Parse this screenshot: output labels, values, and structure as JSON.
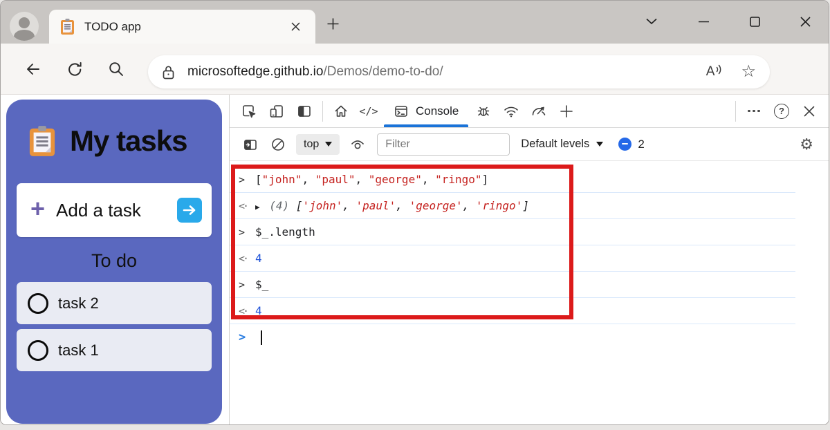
{
  "browser": {
    "tab_title": "TODO app",
    "url_host": "microsoftedge.github.io",
    "url_path": "/Demos/demo-to-do/"
  },
  "todo_app": {
    "title": "My tasks",
    "add_task_label": "Add a task",
    "section_heading": "To do",
    "tasks": [
      {
        "label": "task 2"
      },
      {
        "label": "task 1"
      }
    ]
  },
  "devtools": {
    "console_tab_label": "Console",
    "context_selector": "top",
    "filter_placeholder": "Filter",
    "levels_label": "Default levels",
    "issues_count": "2",
    "prompt_symbol": ">",
    "console_entries": [
      {
        "kind": "input",
        "segments": [
          {
            "t": "[",
            "c": "p"
          },
          {
            "t": "\"john\"",
            "c": "s"
          },
          {
            "t": ", ",
            "c": "p"
          },
          {
            "t": "\"paul\"",
            "c": "s"
          },
          {
            "t": ", ",
            "c": "p"
          },
          {
            "t": "\"george\"",
            "c": "s"
          },
          {
            "t": ", ",
            "c": "p"
          },
          {
            "t": "\"ringo\"",
            "c": "s"
          },
          {
            "t": "]",
            "c": "p"
          }
        ]
      },
      {
        "kind": "output",
        "italic": true,
        "segments": [
          {
            "t": "▶",
            "c": "tri"
          },
          {
            "t": " (4) ",
            "c": "g"
          },
          {
            "t": "[",
            "c": "p"
          },
          {
            "t": "'john'",
            "c": "s"
          },
          {
            "t": ", ",
            "c": "p"
          },
          {
            "t": "'paul'",
            "c": "s"
          },
          {
            "t": ", ",
            "c": "p"
          },
          {
            "t": "'george'",
            "c": "s"
          },
          {
            "t": ", ",
            "c": "p"
          },
          {
            "t": "'ringo'",
            "c": "s"
          },
          {
            "t": "]",
            "c": "p"
          }
        ]
      },
      {
        "kind": "input",
        "segments": [
          {
            "t": "$_.length",
            "c": "p"
          }
        ]
      },
      {
        "kind": "output",
        "segments": [
          {
            "t": "4",
            "c": "n"
          }
        ]
      },
      {
        "kind": "input",
        "segments": [
          {
            "t": "$_",
            "c": "p"
          }
        ]
      },
      {
        "kind": "output",
        "segments": [
          {
            "t": "4",
            "c": "n"
          }
        ]
      }
    ]
  },
  "colors": {
    "accent_purple": "#5a68bf",
    "add_button_blue": "#29a9ea",
    "highlight_red": "#dc1a1a",
    "tab_underline_blue": "#1a73d8",
    "console_string_red": "#c5221f",
    "console_number_blue": "#1d51d8"
  }
}
